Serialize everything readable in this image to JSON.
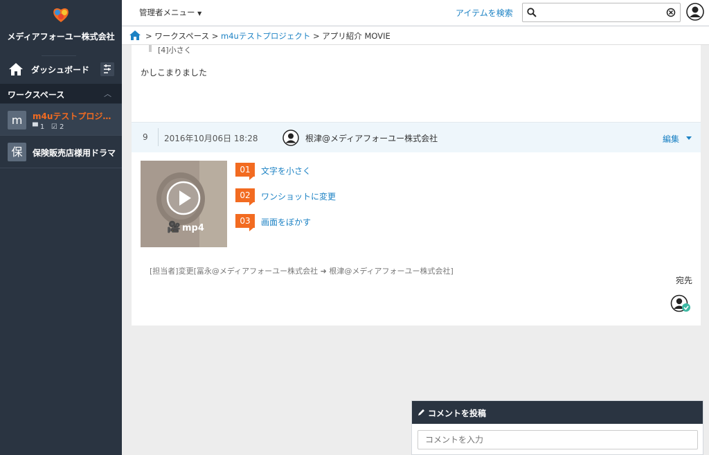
{
  "sidebar": {
    "company": "メディアフォーユー株式会社",
    "dashboard_label": "ダッシュボード",
    "workspace_header": "ワークスペース",
    "workspaces": [
      {
        "avatar": "m",
        "name": "m4uテストプロジ…",
        "comments": "1",
        "tasks": "2"
      },
      {
        "avatar": "保",
        "name": "保険販売店様用ドラマ"
      }
    ]
  },
  "topbar": {
    "admin_menu": "管理者メニュー",
    "search_link": "アイテムを検索",
    "search_value": ""
  },
  "breadcrumb": {
    "workspace": "ワークスペース",
    "project": "m4uテストプロジェクト",
    "item": "アプリ紹介 MOVIE",
    "sep": ">"
  },
  "thread": {
    "prev_quote": "[4]小さく",
    "prev_reply": "かしこまりました",
    "comment": {
      "number": "9",
      "date": "2016年10月06日 18:28",
      "author": "根津@メディアフォーユー株式会社",
      "edit_label": "編集",
      "media_label": "mp4",
      "notes": [
        {
          "badge": "01",
          "text": "文字を小さく"
        },
        {
          "badge": "02",
          "text": "ワンショットに変更"
        },
        {
          "badge": "03",
          "text": "画面をぼかす"
        }
      ],
      "assignee_change": "[担当者]変更[冨永@メディアフォーユー株式会社 ➜ 根津@メディアフォーユー株式会社]",
      "destination_label": "宛先"
    }
  },
  "post": {
    "title": "コメントを投稿",
    "placeholder": "コメントを入力"
  },
  "colors": {
    "sidebar_bg": "#2a3441",
    "accent_orange": "#f26b21",
    "link_blue": "#1c82c4"
  }
}
